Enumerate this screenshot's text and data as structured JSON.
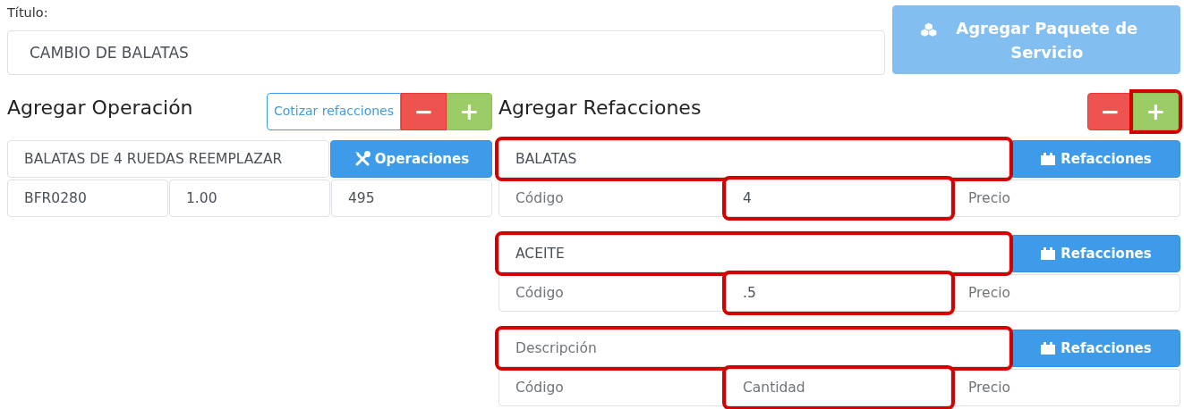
{
  "title_field": {
    "label": "Título:",
    "value": "CAMBIO DE BALATAS"
  },
  "package_button": {
    "label": "Agregar Paquete de Servicio",
    "disabled": true
  },
  "operation": {
    "heading": "Agregar Operación",
    "quote_button": "Cotizar refacciones",
    "remove_button": "−",
    "add_button": "+",
    "description": {
      "value": "BALATAS DE 4 RUEDAS REEMPLAZAR"
    },
    "picker_button": "Operaciones",
    "fields": [
      {
        "value": "BFR0280"
      },
      {
        "value": "1.00"
      },
      {
        "value": "495"
      }
    ]
  },
  "parts": {
    "heading": "Agregar Refacciones",
    "remove_button": "−",
    "add_button": "+",
    "add_highlighted": true,
    "items": [
      {
        "description": {
          "value": "BALATAS",
          "highlighted": true
        },
        "picker_button": "Refacciones",
        "code": {
          "placeholder": "Código",
          "highlighted": false
        },
        "quantity": {
          "value": "4",
          "highlighted": true
        },
        "price": {
          "placeholder": "Precio",
          "highlighted": false
        }
      },
      {
        "description": {
          "value": "ACEITE",
          "highlighted": true
        },
        "picker_button": "Refacciones",
        "code": {
          "placeholder": "Código",
          "highlighted": false
        },
        "quantity": {
          "value": ".5",
          "highlighted": true
        },
        "price": {
          "placeholder": "Precio",
          "highlighted": false
        }
      },
      {
        "description": {
          "placeholder": "Descripción",
          "highlighted": true
        },
        "picker_button": "Refacciones",
        "code": {
          "placeholder": "Código",
          "highlighted": false
        },
        "quantity": {
          "placeholder": "Cantidad",
          "highlighted": true
        },
        "price": {
          "placeholder": "Precio",
          "highlighted": false
        }
      }
    ]
  }
}
